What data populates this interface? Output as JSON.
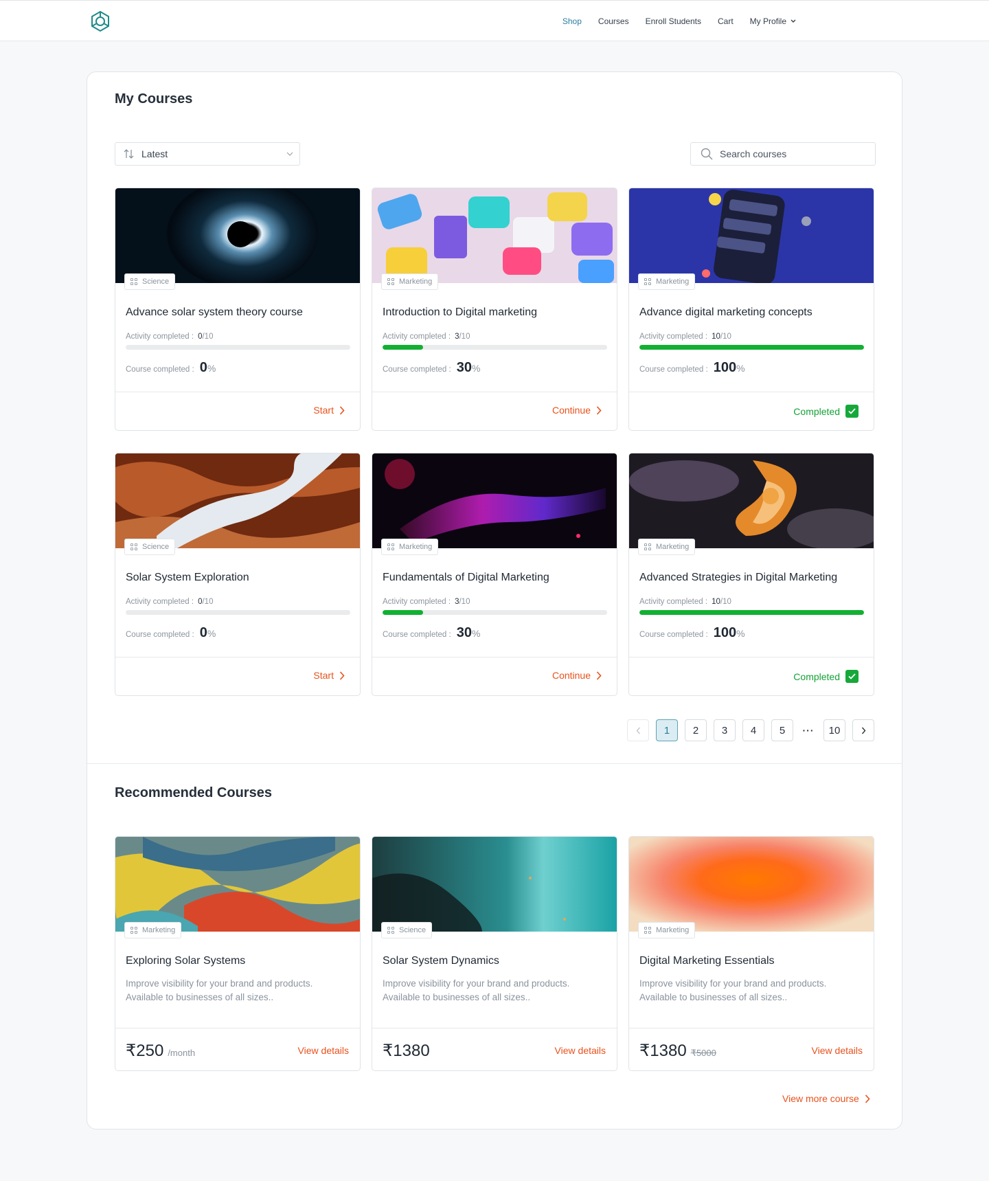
{
  "nav": {
    "links": [
      "Shop",
      "Courses",
      "Enroll Students",
      "Cart",
      "My Profile"
    ],
    "active": "Shop"
  },
  "my_courses": {
    "title": "My Courses",
    "sort_label": "Latest",
    "search_placeholder": "Search courses",
    "activity_label": "Activity completed :",
    "course_label": "Course completed :",
    "courses": [
      {
        "category": "Science",
        "title": "Advance solar system theory course",
        "activity_done": "0",
        "activity_total": "/10",
        "progress": 0,
        "percent": "0",
        "action": "Start",
        "state": "start"
      },
      {
        "category": "Marketing",
        "title": "Introduction to Digital marketing",
        "activity_done": "3",
        "activity_total": "/10",
        "progress": 0.18,
        "percent": "30",
        "action": "Continue",
        "state": "continue"
      },
      {
        "category": "Marketing",
        "title": "Advance digital marketing concepts",
        "activity_done": "10",
        "activity_total": "/10",
        "progress": 1.0,
        "percent": "100",
        "action": "Completed",
        "state": "completed"
      },
      {
        "category": "Science",
        "title": "Solar System Exploration",
        "activity_done": "0",
        "activity_total": "/10",
        "progress": 0,
        "percent": "0",
        "action": "Start",
        "state": "start"
      },
      {
        "category": "Marketing",
        "title": "Fundamentals of Digital Marketing",
        "activity_done": "3",
        "activity_total": "/10",
        "progress": 0.18,
        "percent": "30",
        "action": "Continue",
        "state": "continue"
      },
      {
        "category": "Marketing",
        "title": "Advanced Strategies in Digital Marketing",
        "activity_done": "10",
        "activity_total": "/10",
        "progress": 1.0,
        "percent": "100",
        "action": "Completed",
        "state": "completed"
      }
    ]
  },
  "pagination": {
    "pages": [
      "1",
      "2",
      "3",
      "4",
      "5",
      "10"
    ],
    "current": "1",
    "ellipsis": "···"
  },
  "recommended": {
    "title": "Recommended Courses",
    "view_details": "View details",
    "view_more": "View more course",
    "courses": [
      {
        "category": "Marketing",
        "title": "Exploring Solar Systems",
        "desc1": "Improve visibility for your brand and products.",
        "desc2": "Available to businesses of all sizes..",
        "price": "₹250",
        "suffix": "/month",
        "old_price": ""
      },
      {
        "category": "Science",
        "title": "Solar System Dynamics",
        "desc1": "Improve visibility for your brand and products.",
        "desc2": "Available to businesses of all sizes..",
        "price": "₹1380",
        "suffix": "",
        "old_price": ""
      },
      {
        "category": "Marketing",
        "title": "Digital Marketing Essentials",
        "desc1": "Improve visibility for your brand and products.",
        "desc2": "Available to businesses of all sizes..",
        "price": "₹1380",
        "suffix": "",
        "old_price": "₹5000"
      }
    ]
  },
  "colors": {
    "accent": "#e8511c",
    "success": "#12b032",
    "link": "#2c7da0"
  }
}
